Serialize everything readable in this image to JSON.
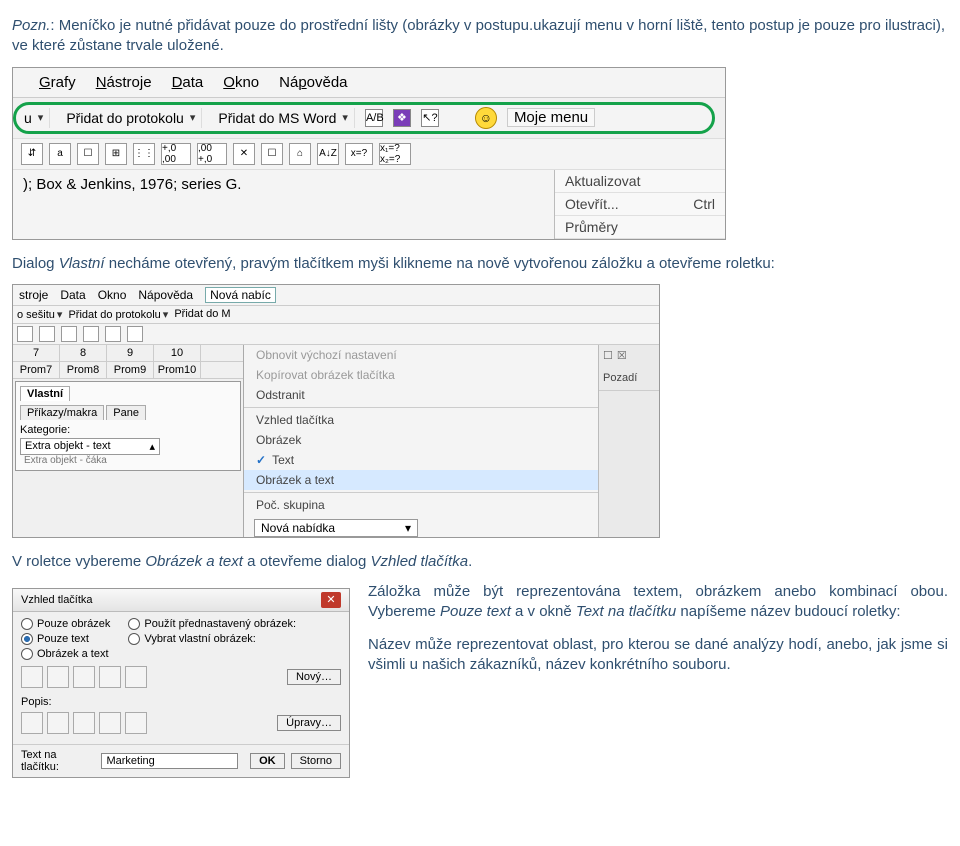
{
  "intro": {
    "note_label": "Pozn.",
    "text": ": Meníčko je nutné přidávat pouze do prostřední lišty (obrázky v postupu.ukazují menu v horní liště, tento postup je pouze pro ilustraci), ve které zůstane trvale uložené."
  },
  "ss1": {
    "menus": [
      "Grafy",
      "Nástroje",
      "Data",
      "Okno",
      "Nápověda"
    ],
    "greenrow": {
      "leftmarker": "u",
      "b1": "Přidat do protokolu",
      "b2": "Přidat do MS Word",
      "ablabel": "A/B",
      "mymenu": "Moje menu"
    },
    "tb2": [
      "a",
      "☐",
      "⊞",
      "⋮⋮",
      "+,0 ,00",
      ",00 +,0",
      "✕",
      "☐",
      "⌂",
      "A↓Z",
      "x=?",
      "x₁=? x₂=?"
    ],
    "lowtext": "); Box & Jenkins, 1976; series G.",
    "ctx": {
      "i1": "Aktualizovat",
      "i2": "Otevřít...",
      "i2s": "Ctrl",
      "i3": "Průměry"
    }
  },
  "mid_para": {
    "p1a": "Dialog ",
    "p1b": "Vlastní",
    "p1c": " necháme otevřený, pravým tlačítkem myši klikneme na nově vytvořenou záložku a otevřeme roletku:"
  },
  "ss2": {
    "menubar": [
      "stroje",
      "Data",
      "Okno",
      "Nápověda"
    ],
    "menubox": "Nová nabíc",
    "tb": [
      "o sešitu",
      "Přidat do protokolu",
      "Přidat do M"
    ],
    "cols_num": [
      "7",
      "8",
      "9",
      "10"
    ],
    "cols_lab": [
      "Prom7",
      "Prom8",
      "Prom9",
      "Prom10"
    ],
    "dialog": {
      "tab_active": "Vlastní",
      "tabrow": [
        "Příkazy/makra",
        "Pane"
      ],
      "kat_label": "Kategorie:",
      "opt1": "Extra objekt - text",
      "opt2": "Extra objekt - čáka"
    },
    "ctx": {
      "reset": "Obnovit výchozí nastavení",
      "copy": "Kopírovat obrázek tlačítka",
      "del": "Odstranit",
      "look": "Vzhled tlačítka",
      "img": "Obrázek",
      "txt": "Text",
      "imgtxt": "Obrázek a text",
      "grp": "Poč. skupina"
    },
    "combo": "Nová nabídka",
    "right": {
      "xbox": "☒",
      "tab": "Pozadí"
    }
  },
  "mid2": {
    "a": "V roletce vybereme ",
    "b": "Obrázek a text",
    "c": " a otevřeme dialog ",
    "d": "Vzhled tlačítka",
    "e": "."
  },
  "ss3": {
    "title": "Vzhled tlačítka",
    "col1": {
      "r1": "Pouze obrázek",
      "r2": "Pouze text",
      "r3": "Obrázek a text"
    },
    "col2": {
      "r1": "Použít přednastavený obrázek:",
      "r2": "Vybrat vlastní obrázek:"
    },
    "btn_new": "Nový…",
    "btn_edit": "Úpravy…",
    "popis": "Popis:",
    "foot_label": "Text na tlačítku:",
    "foot_value": "Marketing",
    "ok": "OK",
    "storno": "Storno"
  },
  "side": {
    "p1a": "Záložka může být reprezentována textem, obrázkem anebo kombinací obou. Vybereme ",
    "p1b": "Pouze text",
    "p1c": " a v okně ",
    "p1d": "Text na tlačítku",
    "p1e": " napíšeme název budoucí roletky:",
    "p2": "Název může reprezentovat oblast, pro kterou se dané analýzy hodí, anebo, jak jsme si všimli u našich zákazníků, název konkrétního souboru."
  }
}
